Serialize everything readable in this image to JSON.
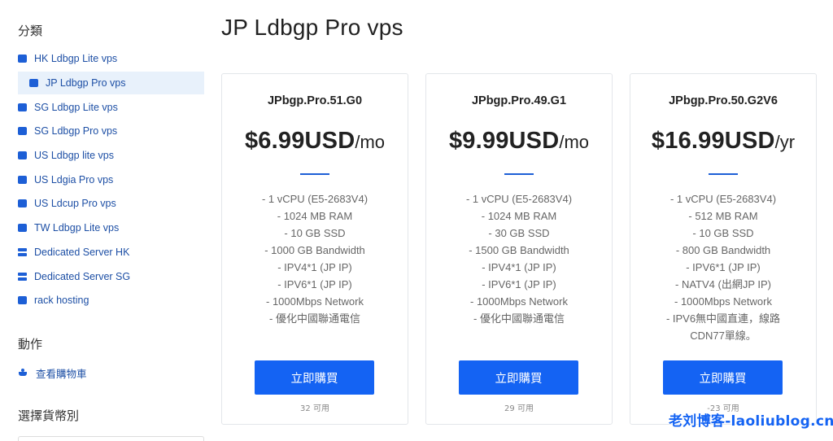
{
  "sidebar": {
    "categories_heading": "分類",
    "categories": [
      {
        "label": "HK Ldbgp Lite vps",
        "icon": "box-icon",
        "active": false
      },
      {
        "label": "JP Ldbgp Pro vps",
        "icon": "box-icon",
        "active": true
      },
      {
        "label": "SG Ldbgp Lite vps",
        "icon": "box-icon",
        "active": false
      },
      {
        "label": "SG Ldbgp Pro vps",
        "icon": "box-icon",
        "active": false
      },
      {
        "label": "US Ldbgp lite vps",
        "icon": "box-icon",
        "active": false
      },
      {
        "label": "US Ldgia Pro vps",
        "icon": "box-icon",
        "active": false
      },
      {
        "label": "US Ldcup Pro vps",
        "icon": "box-icon",
        "active": false
      },
      {
        "label": "TW Ldbgp Lite vps",
        "icon": "box-icon",
        "active": false
      },
      {
        "label": "Dedicated Server HK",
        "icon": "server-icon",
        "active": false
      },
      {
        "label": "Dedicated Server SG",
        "icon": "server-icon",
        "active": false
      },
      {
        "label": "rack hosting",
        "icon": "box-icon",
        "active": false
      }
    ],
    "actions_heading": "動作",
    "actions": [
      {
        "label": "查看購物車",
        "icon": "cart-icon"
      }
    ],
    "currency_heading": "選擇貨幣別"
  },
  "main": {
    "title": "JP Ldbgp Pro vps",
    "products": [
      {
        "name": "JPbgp.Pro.51.G0",
        "price": "$6.99USD",
        "period": "/mo",
        "features": [
          "- 1 vCPU (E5-2683V4)",
          "- 1024 MB RAM",
          "- 10 GB SSD",
          "- 1000 GB Bandwidth",
          "- IPV4*1 (JP IP)",
          "- IPV6*1 (JP IP)",
          "- 1000Mbps Network",
          "- 優化中國聯通電信"
        ],
        "button": "立即購買",
        "availability": "32 可用"
      },
      {
        "name": "JPbgp.Pro.49.G1",
        "price": "$9.99USD",
        "period": "/mo",
        "features": [
          "- 1 vCPU (E5-2683V4)",
          "- 1024 MB RAM",
          "- 30 GB SSD",
          "- 1500 GB Bandwidth",
          "- IPV4*1 (JP IP)",
          "- IPV6*1 (JP IP)",
          "- 1000Mbps Network",
          "- 優化中國聯通電信"
        ],
        "button": "立即購買",
        "availability": "29 可用"
      },
      {
        "name": "JPbgp.Pro.50.G2V6",
        "price": "$16.99USD",
        "period": "/yr",
        "features": [
          "- 1 vCPU (E5-2683V4)",
          "- 512 MB RAM",
          "- 10 GB SSD",
          "- 800 GB Bandwidth",
          "- IPV6*1 (JP IP)",
          "- NATV4 (出網JP IP)",
          "- 1000Mbps Network",
          "- IPV6無中國直連，線路",
          "CDN77單線。"
        ],
        "button": "立即購買",
        "availability": "-23 可用"
      }
    ]
  },
  "watermark": "老刘博客-laoliublog.cn",
  "colors": {
    "accent": "#1463f3",
    "link": "#1d4fa5",
    "active_bg": "#e8f1fb",
    "icon": "#1d5fd6"
  }
}
